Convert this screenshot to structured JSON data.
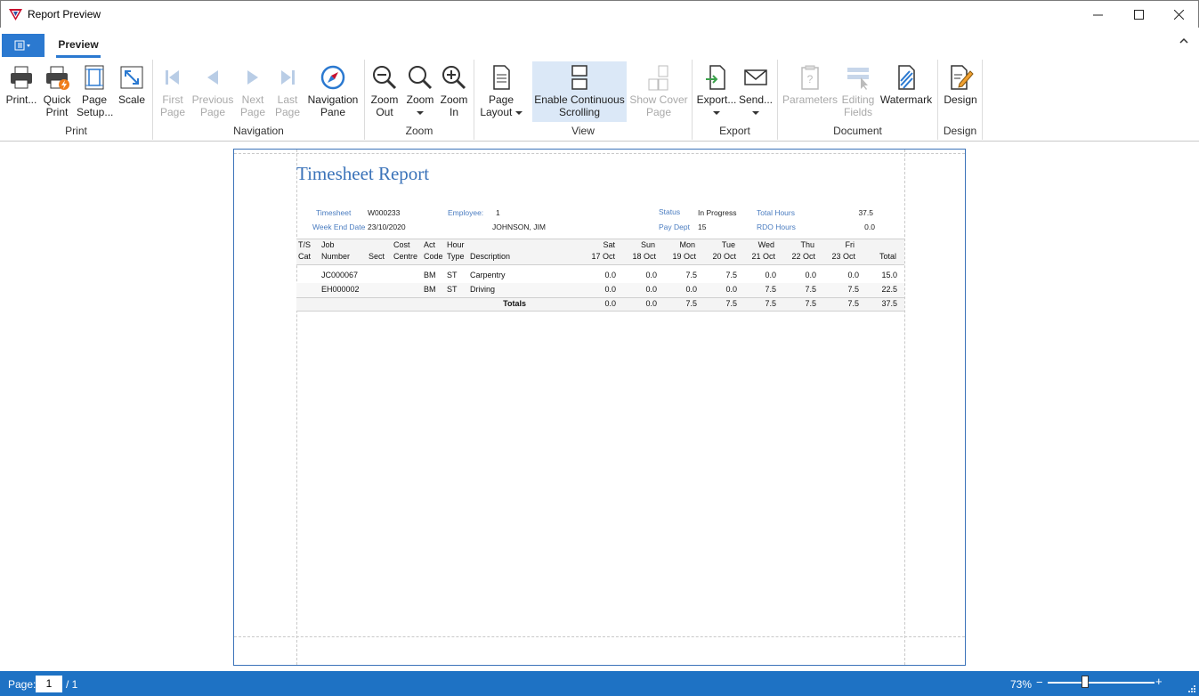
{
  "window": {
    "title": "Report Preview"
  },
  "ribbon": {
    "tab": "Preview",
    "groups": {
      "print": "Print",
      "navigation": "Navigation",
      "zoom": "Zoom",
      "view": "View",
      "export": "Export",
      "document": "Document",
      "design": "Design"
    },
    "buttons": {
      "print": "Print...",
      "quick_print_1": "Quick",
      "quick_print_2": "Print",
      "page_setup_1": "Page",
      "page_setup_2": "Setup...",
      "scale": "Scale",
      "first_page_1": "First",
      "first_page_2": "Page",
      "previous_page_1": "Previous",
      "previous_page_2": "Page",
      "next_page_1": "Next",
      "next_page_2": "Page",
      "last_page_1": "Last",
      "last_page_2": "Page",
      "navigation_pane_1": "Navigation",
      "navigation_pane_2": "Pane",
      "zoom_out_1": "Zoom",
      "zoom_out_2": "Out",
      "zoom": "Zoom",
      "zoom_in_1": "Zoom",
      "zoom_in_2": "In",
      "page_layout_1": "Page",
      "page_layout_2": "Layout",
      "continuous_1": "Enable Continuous",
      "continuous_2": "Scrolling",
      "cover_page_1": "Show Cover",
      "cover_page_2": "Page",
      "export": "Export...",
      "send": "Send...",
      "parameters": "Parameters",
      "editing_fields_1": "Editing",
      "editing_fields_2": "Fields",
      "watermark": "Watermark",
      "design": "Design"
    }
  },
  "report": {
    "title": "Timesheet Report",
    "header": {
      "timesheet_label": "Timesheet",
      "timesheet_value": "W000233",
      "employee_label": "Employee:",
      "employee_value": "1",
      "employee_name": "JOHNSON, JIM",
      "week_end_label": "Week End Date",
      "week_end_value": "23/10/2020",
      "status_label": "Status",
      "status_value": "In Progress",
      "pay_dept_label": "Pay Dept",
      "pay_dept_value": "15",
      "total_hours_label": "Total Hours",
      "total_hours_value": "37.5",
      "rdo_hours_label": "RDO Hours",
      "rdo_hours_value": "0.0"
    },
    "columns": {
      "ts_1": "T/S",
      "ts_2": "Cat",
      "job_1": "Job",
      "job_2": "Number",
      "sect": "Sect",
      "cost_1": "Cost",
      "cost_2": "Centre",
      "act_1": "Act",
      "act_2": "Code",
      "hour_1": "Hour",
      "hour_2": "Type",
      "desc": "Description",
      "sat_1": "Sat",
      "sat_2": "17 Oct",
      "sun_1": "Sun",
      "sun_2": "18 Oct",
      "mon_1": "Mon",
      "mon_2": "19 Oct",
      "tue_1": "Tue",
      "tue_2": "20 Oct",
      "wed_1": "Wed",
      "wed_2": "21 Oct",
      "thu_1": "Thu",
      "thu_2": "22 Oct",
      "fri_1": "Fri",
      "fri_2": "23 Oct",
      "total": "Total"
    },
    "rows": [
      {
        "job": "JC000067",
        "act": "BM",
        "hour": "ST",
        "desc": "Carpentry",
        "sat": "0.0",
        "sun": "0.0",
        "mon": "7.5",
        "tue": "7.5",
        "wed": "0.0",
        "thu": "0.0",
        "fri": "0.0",
        "total": "15.0"
      },
      {
        "job": "EH000002",
        "act": "BM",
        "hour": "ST",
        "desc": "Driving",
        "sat": "0.0",
        "sun": "0.0",
        "mon": "0.0",
        "tue": "0.0",
        "wed": "7.5",
        "thu": "7.5",
        "fri": "7.5",
        "total": "22.5"
      }
    ],
    "totals": {
      "label": "Totals",
      "sat": "0.0",
      "sun": "0.0",
      "mon": "7.5",
      "tue": "7.5",
      "wed": "7.5",
      "thu": "7.5",
      "fri": "7.5",
      "total": "37.5"
    }
  },
  "statusbar": {
    "page_label": "Page:",
    "page_value": "1",
    "page_of": "/ 1",
    "zoom": "73%",
    "zoom_minus": "−",
    "zoom_plus": "+"
  }
}
